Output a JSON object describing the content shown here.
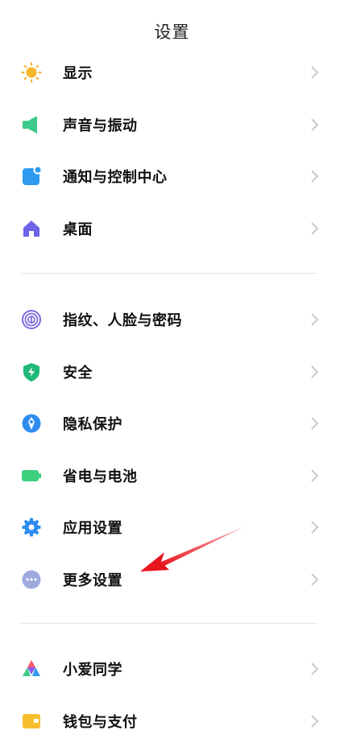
{
  "header": {
    "title": "设置"
  },
  "groups": [
    {
      "items": [
        {
          "label": "显示",
          "icon": "sun-icon",
          "color": "#F7B52C"
        },
        {
          "label": "声音与振动",
          "icon": "speaker-icon",
          "color": "#3DC989"
        },
        {
          "label": "通知与控制中心",
          "icon": "notification-icon",
          "color": "#2E9BF0"
        },
        {
          "label": "桌面",
          "icon": "home-icon",
          "color": "#6B63E8"
        }
      ]
    },
    {
      "items": [
        {
          "label": "指纹、人脸与密码",
          "icon": "fingerprint-icon",
          "color": "#7C6BE0"
        },
        {
          "label": "安全",
          "icon": "shield-icon",
          "color": "#20B97A"
        },
        {
          "label": "隐私保护",
          "icon": "privacy-icon",
          "color": "#2F8CEF"
        },
        {
          "label": "省电与电池",
          "icon": "battery-icon",
          "color": "#3DD07D"
        },
        {
          "label": "应用设置",
          "icon": "gear-icon",
          "color": "#2E8CEF"
        },
        {
          "label": "更多设置",
          "icon": "more-icon",
          "color": "#9EA9DE"
        }
      ]
    },
    {
      "items": [
        {
          "label": "小爱同学",
          "icon": "assistant-icon",
          "color": "#F2596B"
        },
        {
          "label": "钱包与支付",
          "icon": "wallet-icon",
          "color": "#F7BE2E"
        }
      ]
    }
  ],
  "annotation": {
    "arrow_color": "#E8141E",
    "points_to": "更多设置"
  }
}
